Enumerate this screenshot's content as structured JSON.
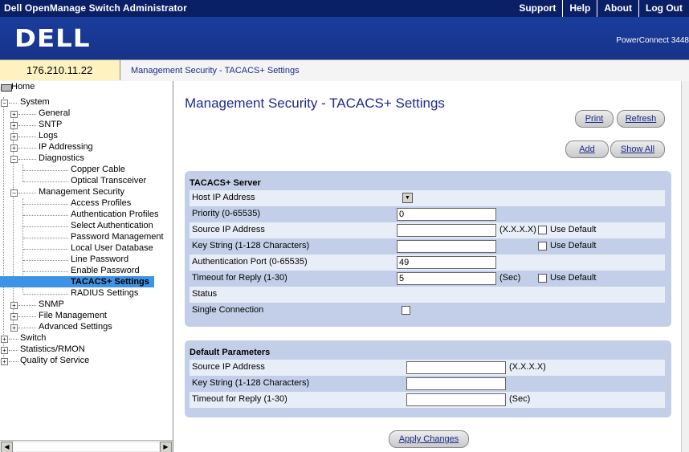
{
  "app": {
    "title": "Dell OpenManage Switch Administrator"
  },
  "top_links": [
    "Support",
    "Help",
    "About",
    "Log Out"
  ],
  "banner": {
    "logo": "DELL",
    "product": "PowerConnect 3448"
  },
  "address": {
    "ip": "176.210.11.22",
    "breadcrumb": "Management Security - TACACS+ Settings"
  },
  "tree": {
    "home": "Home",
    "system": "System",
    "general": "General",
    "sntp": "SNTP",
    "logs": "Logs",
    "ip_addressing": "IP Addressing",
    "diagnostics": "Diagnostics",
    "copper_cable": "Copper Cable",
    "optical_transceiver": "Optical Transceiver",
    "management_security": "Management Security",
    "access_profiles": "Access Profiles",
    "authentication_profiles": "Authentication Profiles",
    "select_authentication": "Select Authentication",
    "password_management": "Password Management",
    "local_user_database": "Local User Database",
    "line_password": "Line Password",
    "enable_password": "Enable Password",
    "tacacs_settings": "TACACS+ Settings",
    "radius_settings": "RADIUS Settings",
    "snmp": "SNMP",
    "file_management": "File Management",
    "advanced_settings": "Advanced Settings",
    "switch": "Switch",
    "statistics_rmon": "Statistics/RMON",
    "quality_of_service": "Quality of Service"
  },
  "page": {
    "title": "Management Security - TACACS+ Settings",
    "buttons": {
      "print": "Print",
      "refresh": "Refresh",
      "add": "Add",
      "show_all": "Show All",
      "apply": "Apply Changes"
    }
  },
  "server": {
    "heading": "TACACS+ Server",
    "host_ip_label": "Host IP Address",
    "priority_label": "Priority (0-65535)",
    "priority_value": "0",
    "source_ip_label": "Source IP Address",
    "source_ip_value": "",
    "source_ip_hint": "(X.X.X.X)",
    "key_string_label": "Key String (1-128 Characters)",
    "key_string_value": "",
    "auth_port_label": "Authentication Port (0-65535)",
    "auth_port_value": "49",
    "timeout_label": "Timeout for Reply (1-30)",
    "timeout_value": "5",
    "timeout_unit": "(Sec)",
    "use_default": "Use Default",
    "status_label": "Status",
    "single_connection_label": "Single Connection"
  },
  "defaults": {
    "heading": "Default Parameters",
    "source_ip_label": "Source IP Address",
    "source_ip_value": "",
    "source_ip_hint": "(X.X.X.X)",
    "key_string_label": "Key String (1-128 Characters)",
    "key_string_value": "",
    "timeout_label": "Timeout for Reply (1-30)",
    "timeout_value": "",
    "timeout_unit": "(Sec)"
  }
}
